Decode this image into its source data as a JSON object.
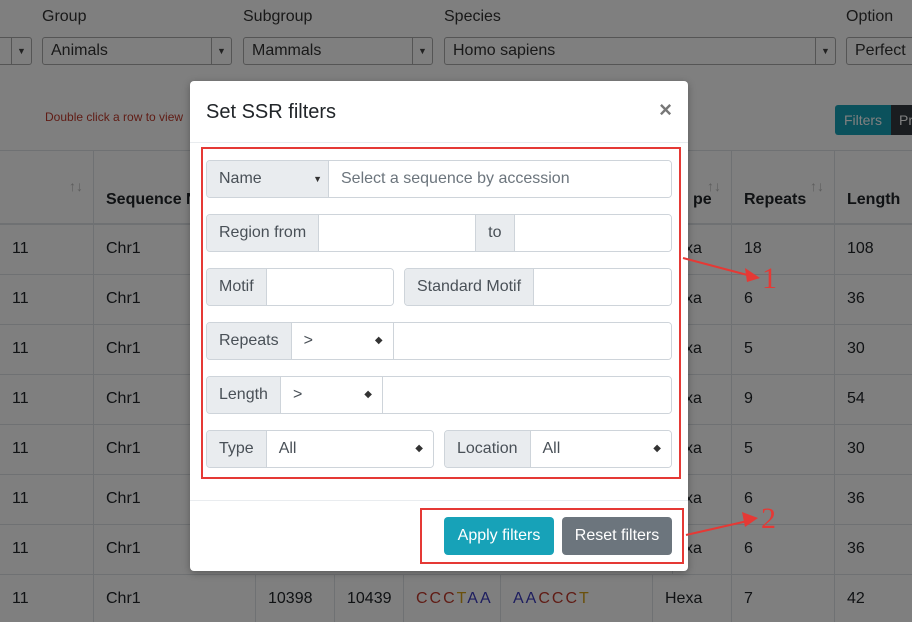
{
  "top_filters": {
    "group_label": "Group",
    "group_value": "Animals",
    "subgroup_label": "Subgroup",
    "subgroup_value": "Mammals",
    "species_label": "Species",
    "species_value": "Homo sapiens",
    "option_label": "Option",
    "option_value": "Perfect"
  },
  "hint": "Double click a row to view",
  "toolbar": {
    "filters_label": "Filters",
    "other_label": "Pr"
  },
  "table": {
    "headers": [
      "",
      "Sequence N",
      "",
      "",
      "",
      "",
      "pe",
      "Repeats",
      "Length"
    ],
    "rows": [
      {
        "id": "11",
        "seq": "Chr1",
        "start": "",
        "end": "",
        "motif": "",
        "std": "",
        "type": "xa",
        "repeats": "18",
        "length": "108"
      },
      {
        "id": "11",
        "seq": "Chr1",
        "start": "",
        "end": "",
        "motif": "",
        "std": "",
        "type": "xa",
        "repeats": "6",
        "length": "36"
      },
      {
        "id": "11",
        "seq": "Chr1",
        "start": "",
        "end": "",
        "motif": "",
        "std": "",
        "type": "xa",
        "repeats": "5",
        "length": "30"
      },
      {
        "id": "11",
        "seq": "Chr1",
        "start": "",
        "end": "",
        "motif": "",
        "std": "",
        "type": "xa",
        "repeats": "9",
        "length": "54"
      },
      {
        "id": "11",
        "seq": "Chr1",
        "start": "",
        "end": "",
        "motif": "",
        "std": "",
        "type": "xa",
        "repeats": "5",
        "length": "30"
      },
      {
        "id": "11",
        "seq": "Chr1",
        "start": "",
        "end": "",
        "motif": "",
        "std": "",
        "type": "xa",
        "repeats": "6",
        "length": "36"
      },
      {
        "id": "11",
        "seq": "Chr1",
        "start": "",
        "end": "",
        "motif": "",
        "std": "",
        "type": "xa",
        "repeats": "6",
        "length": "36"
      },
      {
        "id": "11",
        "seq": "Chr1",
        "start": "10398",
        "end": "10439",
        "motif": "CCCTAA",
        "std": "AACCCT",
        "type": "Hexa",
        "repeats": "7",
        "length": "42"
      }
    ]
  },
  "modal": {
    "title": "Set SSR filters",
    "close_symbol": "×",
    "name_select": "Name",
    "name_placeholder": "Select a sequence by accession",
    "region_from_label": "Region from",
    "region_to_label": "to",
    "motif_label": "Motif",
    "standard_motif_label": "Standard Motif",
    "repeats_label": "Repeats",
    "repeats_op": ">",
    "length_label": "Length",
    "length_op": ">",
    "type_label": "Type",
    "type_value": "All",
    "location_label": "Location",
    "location_value": "All",
    "apply_label": "Apply filters",
    "reset_label": "Reset filters"
  },
  "annotations": {
    "callout_1": "1",
    "callout_2": "2"
  },
  "colors": {
    "accent": "#17a2b8",
    "secondary": "#6c757d",
    "annotation": "#e53935",
    "motif_c": "#c0392b",
    "motif_t": "#d4a017",
    "motif_a": "#3b3bbf"
  },
  "icons": {
    "sort": "sort-icon",
    "close": "close-icon",
    "caret": "caret-down-icon"
  }
}
